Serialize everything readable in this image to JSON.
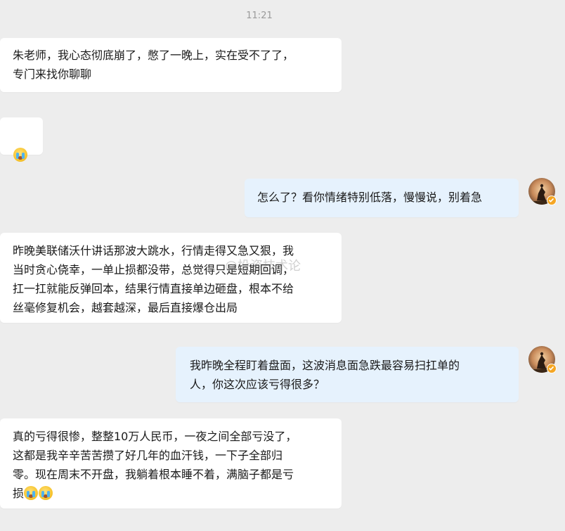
{
  "chat": {
    "timestamp": "11:21",
    "messages": [
      {
        "side": "left",
        "text": "朱老师，我心态彻底崩了，憋了一晚上，实在受不了了，\n专门来找你聊聊"
      },
      {
        "side": "left",
        "emoji": "crying-emoji"
      },
      {
        "side": "right",
        "text": "怎么了？看你情绪特别低落，慢慢说，别着急"
      },
      {
        "side": "left",
        "text": "昨晚美联储沃什讲话那波大跳水，行情走得又急又狠，我\n当时贪心侥幸，一单止损都没带，总觉得只是短期回调，\n扛一扛就能反弹回本，结果行情直接单边砸盘，根本不给\n丝毫修复机会，越套越深，最后直接爆仓出局"
      },
      {
        "side": "right",
        "text": "我昨晚全程盯着盘面，这波消息面急跌最容易扫扛单的\n人，你这次应该亏得很多？"
      },
      {
        "side": "left",
        "text": "真的亏得很惨，整整10万人民币，一夜之间全部亏没了，\n这都是我辛辛苦苦攒了好几年的血汗钱，一下子全部归\n零。现在周末不开盘，我躺着根本睡不着，满脑子都是亏\n损",
        "emoji_suffix": 2
      }
    ],
    "watermark": "@投资技术论"
  },
  "colors": {
    "background": "#ededed",
    "bubble_left": "#ffffff",
    "bubble_right": "#e6f2fd",
    "badge": "#f5a623"
  }
}
